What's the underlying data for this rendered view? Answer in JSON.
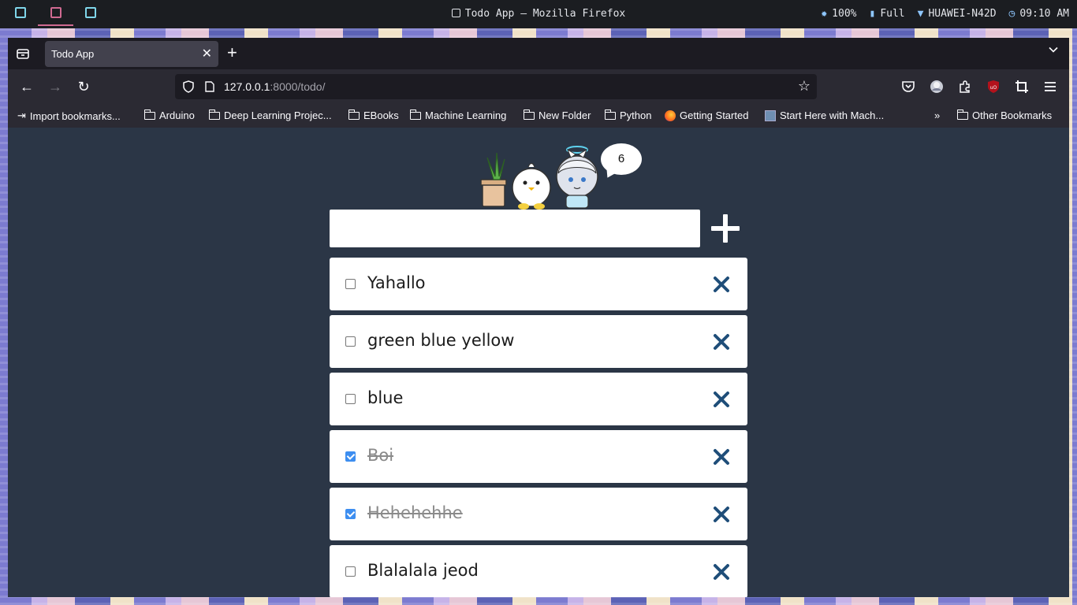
{
  "system": {
    "window_title": "Todo App — Mozilla Firefox",
    "brightness": "100%",
    "battery": "Full",
    "wifi": "HUAWEI-N42D",
    "time": "09:10 AM"
  },
  "browser": {
    "tab_title": "Todo App",
    "url_host": "127.0.0.1",
    "url_rest": ":8000/todo/",
    "bookmarks": [
      {
        "label": "Import bookmarks...",
        "icon": "import-icon"
      },
      {
        "label": "Arduino",
        "icon": "folder-icon"
      },
      {
        "label": "Deep Learning Projec...",
        "icon": "folder-icon"
      },
      {
        "label": "EBooks",
        "icon": "folder-icon"
      },
      {
        "label": "Machine Learning",
        "icon": "folder-icon"
      },
      {
        "label": "New Folder",
        "icon": "folder-icon"
      },
      {
        "label": "Python",
        "icon": "folder-icon"
      },
      {
        "label": "Getting Started",
        "icon": "firefox-icon"
      },
      {
        "label": "Start Here with Mach...",
        "icon": "site-icon"
      }
    ],
    "other_bookmarks": "Other Bookmarks"
  },
  "app": {
    "task_count": "6",
    "input_value": "",
    "todos": [
      {
        "text": "Yahallo",
        "completed": false
      },
      {
        "text": "green blue yellow",
        "completed": false
      },
      {
        "text": "blue",
        "completed": false
      },
      {
        "text": "Boi",
        "completed": true
      },
      {
        "text": "Hehehehhe",
        "completed": true
      },
      {
        "text": "Blalalala jeod",
        "completed": false
      }
    ]
  },
  "colors": {
    "page_background": "#2b3646",
    "delete_icon": "#1f4e79",
    "checkbox_checked": "#3d8ef0"
  }
}
